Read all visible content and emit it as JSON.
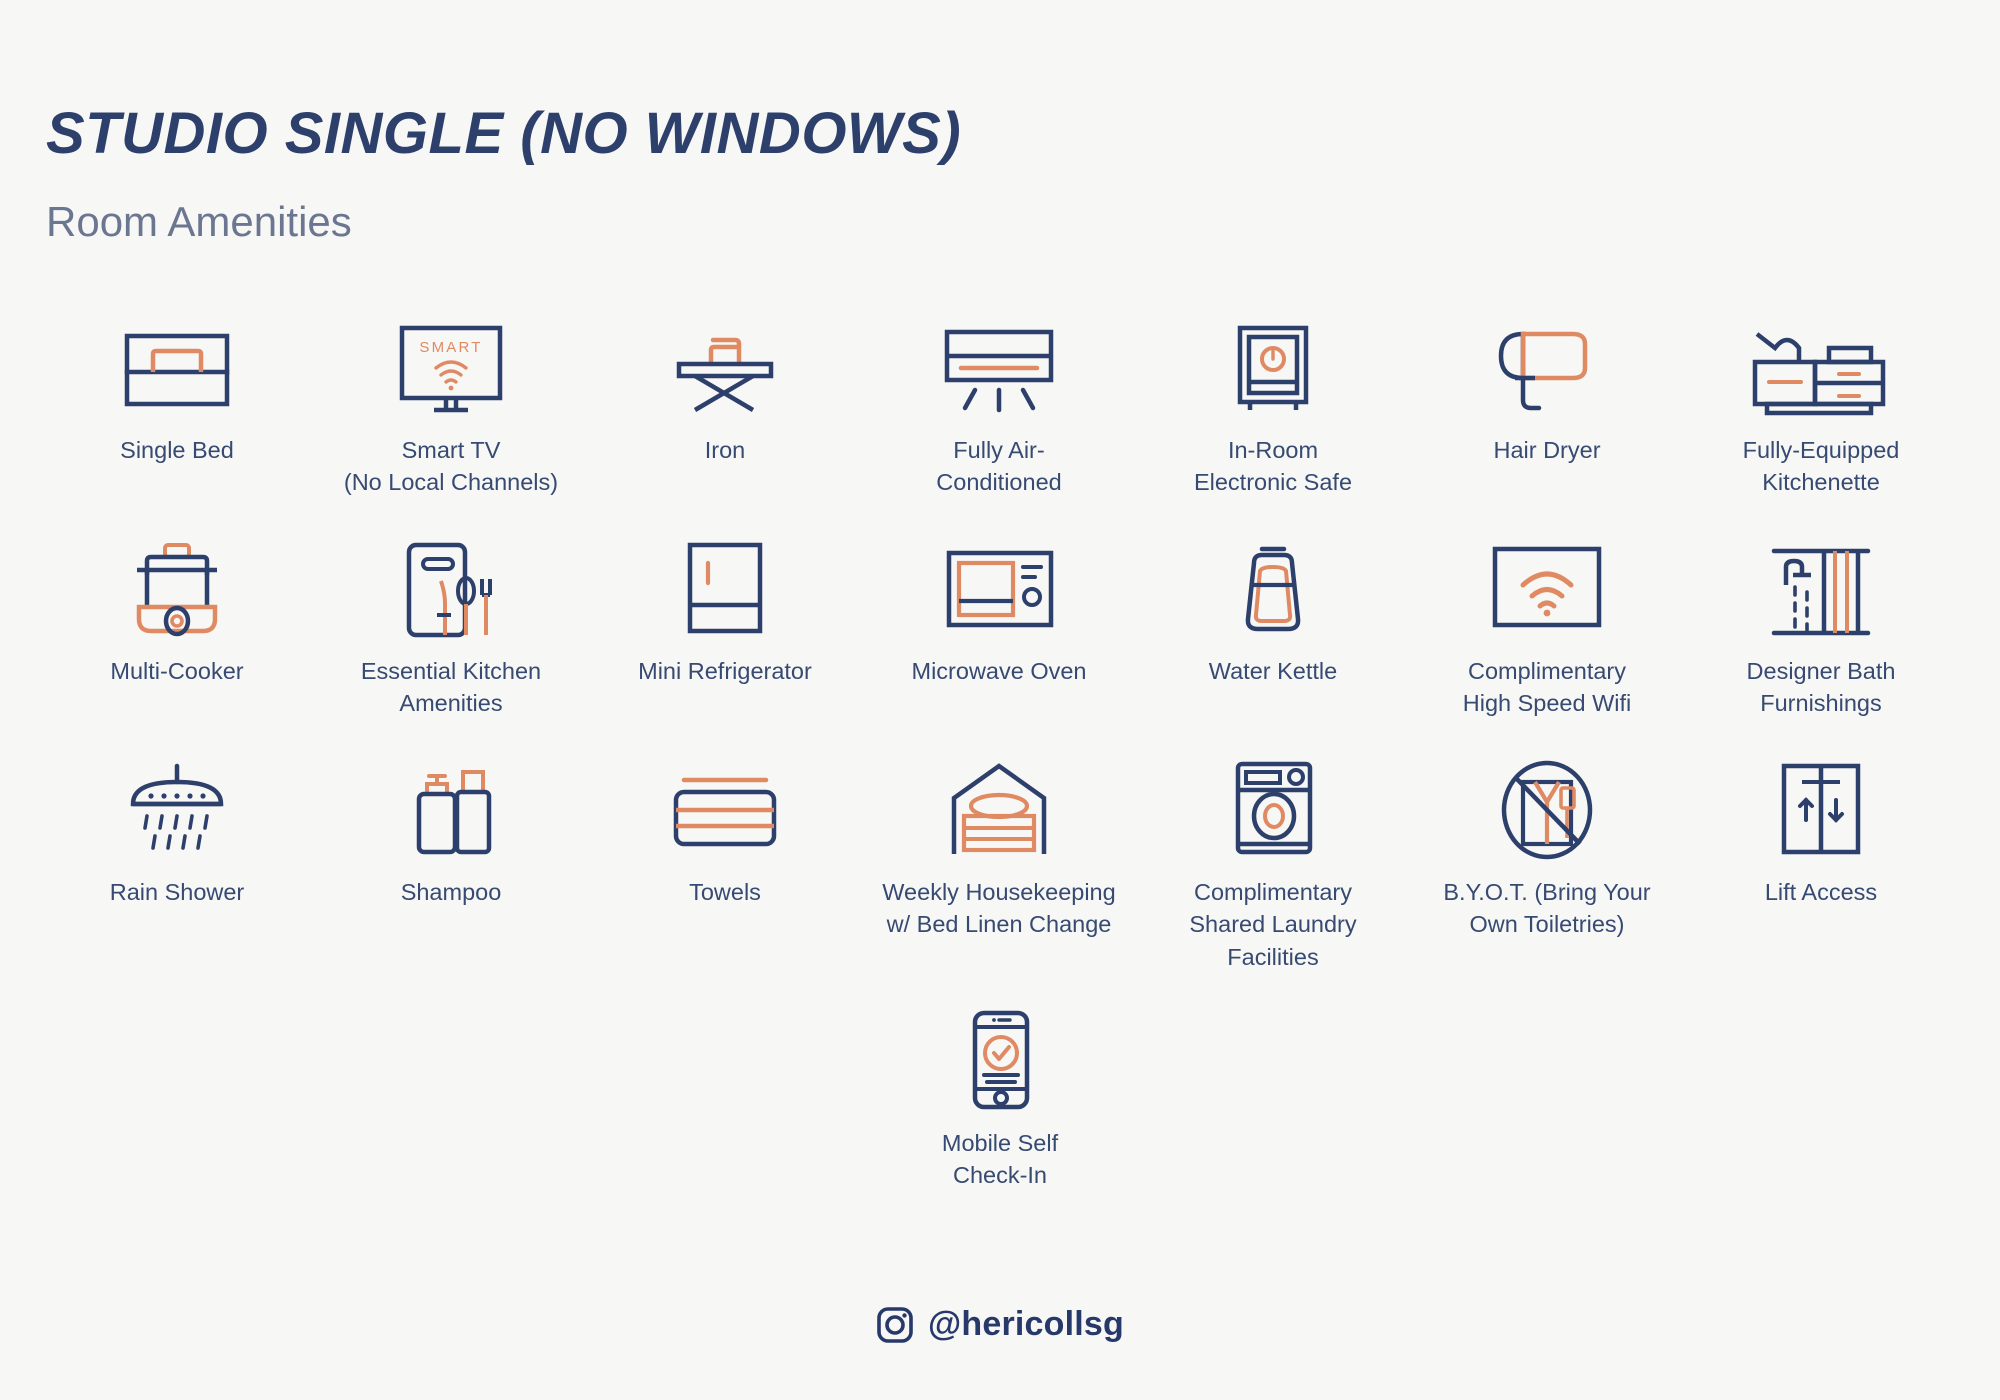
{
  "header": {
    "title": "STUDIO SINGLE (NO WINDOWS)",
    "subtitle": "Room Amenities"
  },
  "colors": {
    "background": "#f7f7f5",
    "navy": "#2d3f6b",
    "navy_text": "#374a72",
    "orange": "#e08a63",
    "subtitle_gray": "#6b7790"
  },
  "amenities": {
    "row1": [
      {
        "icon": "single-bed-icon",
        "label": "Single Bed"
      },
      {
        "icon": "smart-tv-icon",
        "label": "Smart TV\n(No Local Channels)",
        "line1": "Smart TV",
        "line2": "(No Local Channels)",
        "screen_text": "SMART"
      },
      {
        "icon": "iron-icon",
        "label": "Iron"
      },
      {
        "icon": "air-conditioner-icon",
        "line1": "Fully Air-",
        "line2": "Conditioned"
      },
      {
        "icon": "electronic-safe-icon",
        "line1": "In-Room",
        "line2": "Electronic Safe"
      },
      {
        "icon": "hair-dryer-icon",
        "label": "Hair Dryer"
      },
      {
        "icon": "kitchenette-icon",
        "line1": "Fully-Equipped",
        "line2": "Kitchenette"
      }
    ],
    "row2": [
      {
        "icon": "multi-cooker-icon",
        "label": "Multi-Cooker"
      },
      {
        "icon": "kitchen-utensils-icon",
        "line1": "Essential Kitchen",
        "line2": "Amenities"
      },
      {
        "icon": "mini-refrigerator-icon",
        "label": "Mini Refrigerator"
      },
      {
        "icon": "microwave-oven-icon",
        "label": "Microwave Oven"
      },
      {
        "icon": "water-kettle-icon",
        "label": "Water Kettle"
      },
      {
        "icon": "wifi-icon",
        "line1": "Complimentary",
        "line2": "High Speed Wifi"
      },
      {
        "icon": "shower-curtain-icon",
        "line1": "Designer Bath",
        "line2": "Furnishings"
      }
    ],
    "row3": [
      {
        "icon": "rain-shower-icon",
        "label": "Rain Shower"
      },
      {
        "icon": "shampoo-bottles-icon",
        "label": "Shampoo"
      },
      {
        "icon": "towels-icon",
        "label": "Towels"
      },
      {
        "icon": "housekeeping-linen-icon",
        "line1": "Weekly Housekeeping",
        "line2": "w/ Bed Linen Change"
      },
      {
        "icon": "laundry-machine-icon",
        "line1": "Complimentary",
        "line2": "Shared Laundry",
        "line3": "Facilities"
      },
      {
        "icon": "no-toiletries-icon",
        "line1": "B.Y.O.T. (Bring Your",
        "line2": "Own Toiletries)"
      },
      {
        "icon": "lift-access-icon",
        "label": "Lift Access"
      }
    ],
    "row4": [
      {
        "icon": "mobile-checkin-icon",
        "line1": "Mobile Self",
        "line2": "Check-In"
      }
    ]
  },
  "footer": {
    "icon": "instagram-icon",
    "handle": "@hericollsg"
  }
}
